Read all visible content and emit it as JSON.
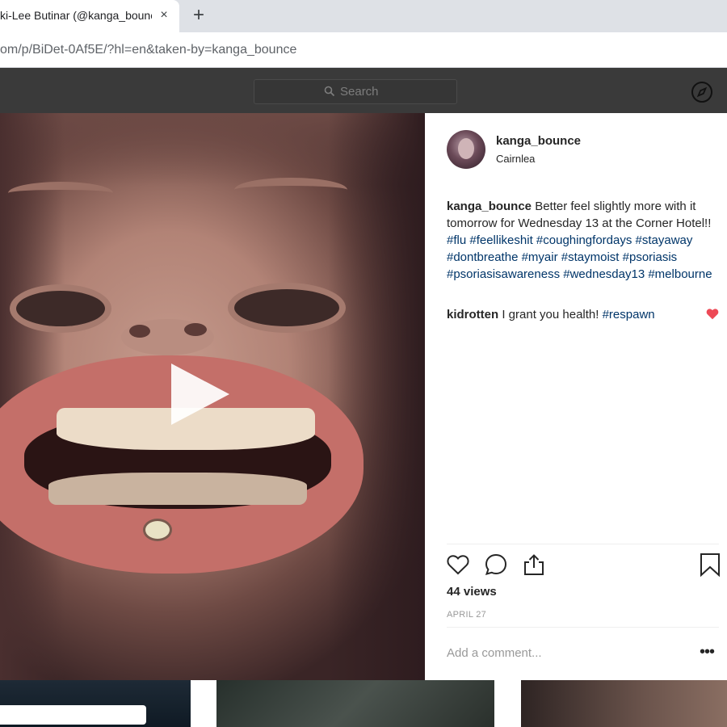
{
  "browser": {
    "tab_title": "ki-Lee Butinar (@kanga_bounce",
    "tab_close": "×",
    "new_tab": "+",
    "url_host": "om",
    "url_path": "/p/BiDet-0Af5E/?hl=en&taken-by=kanga_bounce"
  },
  "header": {
    "search_placeholder": "Search",
    "compass_icon": "compass-icon"
  },
  "post": {
    "username": "kanga_bounce",
    "location": "Cairnlea",
    "caption_user": "kanga_bounce",
    "caption_text": " Better feel slightly more with it tomorrow for Wednesday 13 at the Corner Hotel!! ",
    "hashtags": [
      "#flu",
      "#feellikeshit",
      "#coughingfordays",
      "#stayaway",
      "#dontbreathe",
      "#myair",
      "#staymoist",
      "#psoriasis",
      "#psoriasisawareness",
      "#wednesday13",
      "#melbourne"
    ],
    "comment_user": "kidrotten",
    "comment_text": " I grant you health! ",
    "comment_tag": "#respawn",
    "views": "44 views",
    "date": "APRIL 27",
    "add_comment_placeholder": "Add a comment...",
    "more": "•••"
  },
  "colors": {
    "header_bg": "#3a3a3a",
    "hashtag": "#003569",
    "like_red": "#ed4956"
  }
}
